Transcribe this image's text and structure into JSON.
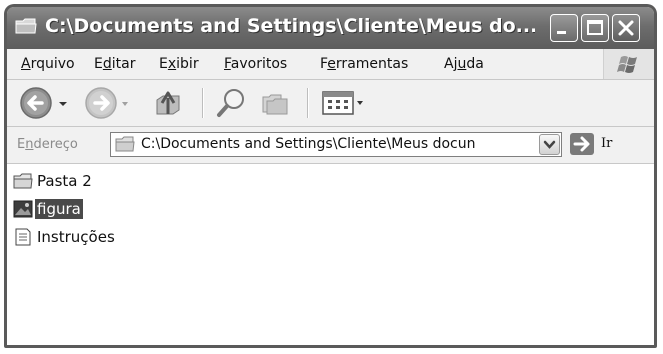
{
  "window": {
    "title": "C:\\Documents and Settings\\Cliente\\Meus do..."
  },
  "menu": {
    "items": [
      {
        "pre": "",
        "key": "A",
        "post": "rquivo"
      },
      {
        "pre": "E",
        "key": "d",
        "post": "itar"
      },
      {
        "pre": "E",
        "key": "x",
        "post": "ibir"
      },
      {
        "pre": "",
        "key": "F",
        "post": "avoritos"
      },
      {
        "pre": "F",
        "key": "e",
        "post": "rramentas"
      },
      {
        "pre": "Aj",
        "key": "u",
        "post": "da"
      }
    ]
  },
  "toolbar": {
    "icons": [
      "back-icon",
      "forward-icon",
      "up-folder-icon",
      "search-icon",
      "folders-icon",
      "views-icon"
    ]
  },
  "address": {
    "label_pre": "E",
    "label_key": "n",
    "label_post": "dereço",
    "value": "C:\\Documents and Settings\\Cliente\\Meus docun",
    "go_label": "Ir"
  },
  "files": [
    {
      "name": "Pasta 2",
      "icon": "folder-icon",
      "selected": false
    },
    {
      "name": "figura",
      "icon": "image-file-icon",
      "selected": true
    },
    {
      "name": "Instruções",
      "icon": "text-file-icon",
      "selected": false
    }
  ],
  "colors": {
    "title_bar": "#6d6d6d",
    "selection": "#4a4a4a"
  }
}
